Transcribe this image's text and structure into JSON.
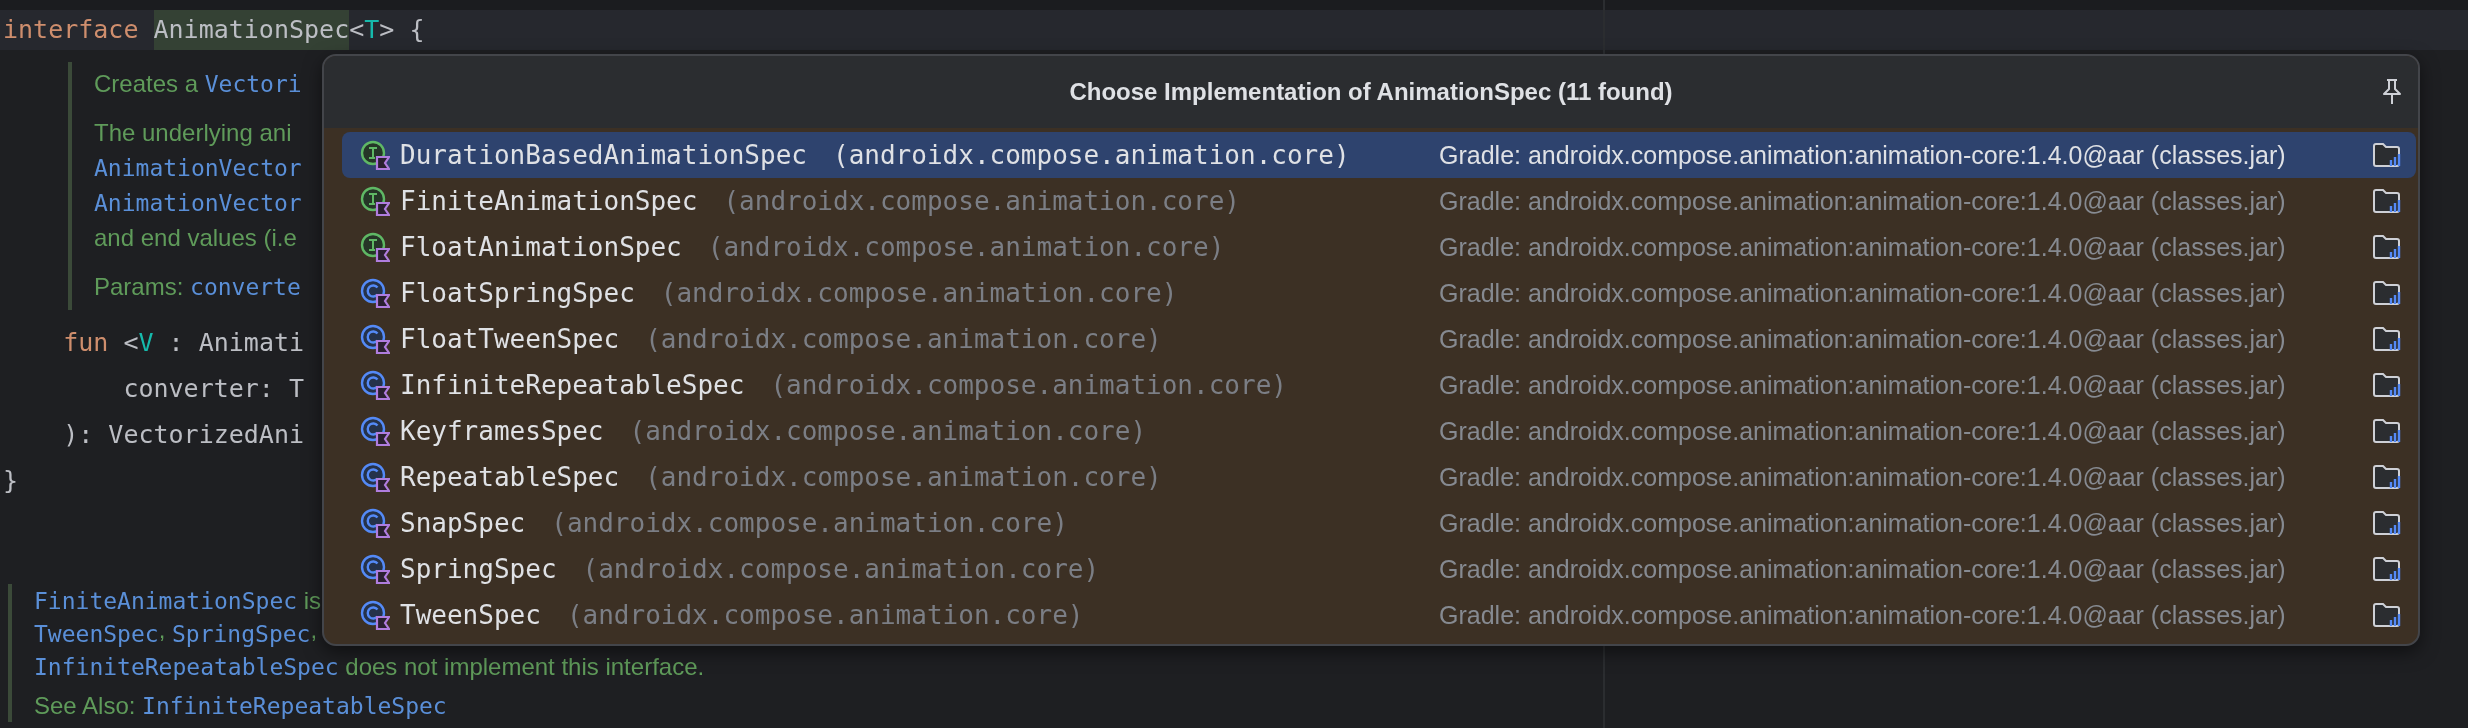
{
  "editor": {
    "blocks": [
      {
        "kind": "code",
        "current": true,
        "tokens": [
          {
            "text": "interface ",
            "kind": "keyword"
          },
          {
            "text": "AnimationSpec",
            "kind": "match"
          },
          {
            "text": "<",
            "kind": "plain"
          },
          {
            "text": "T",
            "kind": "type-param"
          },
          {
            "text": "> {",
            "kind": "plain"
          }
        ]
      },
      {
        "kind": "doc",
        "paragraphs": [
          [
            [
              {
                "text": "Creates a ",
                "kind": "text"
              },
              {
                "text": "Vectori",
                "kind": "code"
              }
            ]
          ],
          [
            [
              {
                "text": "The underlying ani",
                "kind": "text"
              }
            ],
            [
              {
                "text": "AnimationVector",
                "kind": "code"
              }
            ],
            [
              {
                "text": "AnimationVector",
                "kind": "code"
              }
            ],
            [
              {
                "text": "and end values (i.e",
                "kind": "text"
              }
            ]
          ],
          [
            [
              {
                "text": "Params: ",
                "kind": "text"
              },
              {
                "text": "converte",
                "kind": "code"
              }
            ]
          ]
        ]
      },
      {
        "kind": "code",
        "current": false,
        "tokens": [
          {
            "text": "    fun",
            "kind": "keyword"
          },
          {
            "text": " <",
            "kind": "plain"
          },
          {
            "text": "V",
            "kind": "type-param"
          },
          {
            "text": " : Animati",
            "kind": "plain"
          }
        ]
      },
      {
        "kind": "code",
        "current": false,
        "tokens": [
          {
            "text": "        converter: T",
            "kind": "plain"
          }
        ]
      },
      {
        "kind": "code",
        "current": false,
        "tokens": [
          {
            "text": "    ): VectorizedAni",
            "kind": "plain"
          }
        ]
      },
      {
        "kind": "code",
        "current": false,
        "tokens": [
          {
            "text": "}",
            "kind": "plain"
          }
        ]
      },
      {
        "kind": "doc",
        "paragraphs": [
          [
            [
              {
                "text": "FiniteAnimationSpec",
                "kind": "code"
              },
              {
                "text": " is",
                "kind": "text"
              }
            ],
            [
              {
                "text": "TweenSpec",
                "kind": "code"
              },
              {
                "text": ", ",
                "kind": "text"
              },
              {
                "text": "SpringSpec",
                "kind": "code"
              },
              {
                "text": ",",
                "kind": "text"
              }
            ],
            [
              {
                "text": "InfiniteRepeatableSpec",
                "kind": "code"
              },
              {
                "text": " does not implement this interface.",
                "kind": "text"
              }
            ]
          ],
          [
            [
              {
                "text": "See Also: ",
                "kind": "text"
              },
              {
                "text": "InfiniteRepeatableSpec",
                "kind": "code"
              }
            ]
          ]
        ]
      }
    ]
  },
  "popup": {
    "title": "Choose Implementation of AnimationSpec (11 found)",
    "items": [
      {
        "kind": "interface",
        "name": "DurationBasedAnimationSpec",
        "package": "(androidx.compose.animation.core)",
        "library": "Gradle: androidx.compose.animation:animation-core:1.4.0@aar (classes.jar)",
        "selected": true
      },
      {
        "kind": "interface",
        "name": "FiniteAnimationSpec",
        "package": "(androidx.compose.animation.core)",
        "library": "Gradle: androidx.compose.animation:animation-core:1.4.0@aar (classes.jar)",
        "selected": false
      },
      {
        "kind": "interface",
        "name": "FloatAnimationSpec",
        "package": "(androidx.compose.animation.core)",
        "library": "Gradle: androidx.compose.animation:animation-core:1.4.0@aar (classes.jar)",
        "selected": false
      },
      {
        "kind": "class",
        "name": "FloatSpringSpec",
        "package": "(androidx.compose.animation.core)",
        "library": "Gradle: androidx.compose.animation:animation-core:1.4.0@aar (classes.jar)",
        "selected": false
      },
      {
        "kind": "class",
        "name": "FloatTweenSpec",
        "package": "(androidx.compose.animation.core)",
        "library": "Gradle: androidx.compose.animation:animation-core:1.4.0@aar (classes.jar)",
        "selected": false
      },
      {
        "kind": "class",
        "name": "InfiniteRepeatableSpec",
        "package": "(androidx.compose.animation.core)",
        "library": "Gradle: androidx.compose.animation:animation-core:1.4.0@aar (classes.jar)",
        "selected": false
      },
      {
        "kind": "class",
        "name": "KeyframesSpec",
        "package": "(androidx.compose.animation.core)",
        "library": "Gradle: androidx.compose.animation:animation-core:1.4.0@aar (classes.jar)",
        "selected": false
      },
      {
        "kind": "class",
        "name": "RepeatableSpec",
        "package": "(androidx.compose.animation.core)",
        "library": "Gradle: androidx.compose.animation:animation-core:1.4.0@aar (classes.jar)",
        "selected": false
      },
      {
        "kind": "class",
        "name": "SnapSpec",
        "package": "(androidx.compose.animation.core)",
        "library": "Gradle: androidx.compose.animation:animation-core:1.4.0@aar (classes.jar)",
        "selected": false
      },
      {
        "kind": "class",
        "name": "SpringSpec",
        "package": "(androidx.compose.animation.core)",
        "library": "Gradle: androidx.compose.animation:animation-core:1.4.0@aar (classes.jar)",
        "selected": false
      },
      {
        "kind": "class",
        "name": "TweenSpec",
        "package": "(androidx.compose.animation.core)",
        "library": "Gradle: androidx.compose.animation:animation-core:1.4.0@aar (classes.jar)",
        "selected": false
      }
    ]
  }
}
